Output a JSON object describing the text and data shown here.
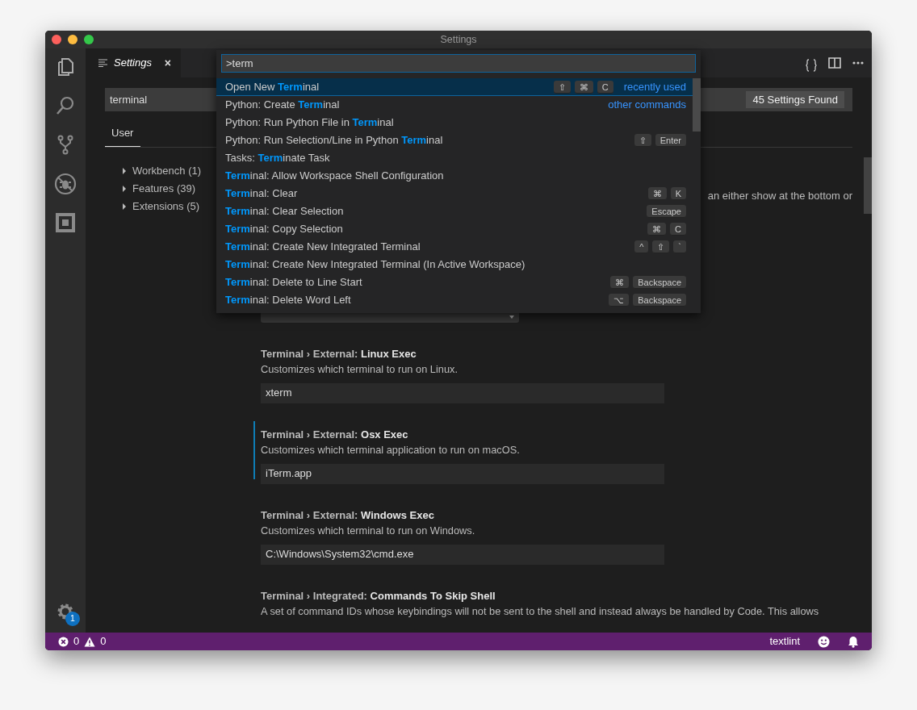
{
  "window": {
    "title": "Settings"
  },
  "activity_bar": {
    "badge": "1"
  },
  "tabs": [
    {
      "label": "Settings",
      "selected": true,
      "close": "×"
    }
  ],
  "search": {
    "value": "terminal",
    "result_count": "45 Settings Found"
  },
  "scope_tabs": [
    {
      "label": "User",
      "selected": true
    }
  ],
  "tree": [
    {
      "label": "Workbench (1)",
      "expanded": false
    },
    {
      "label": "Features (39)",
      "expanded": false
    },
    {
      "label": "Extensions (5)",
      "expanded": false
    }
  ],
  "partial_description": "an either show at the bottom or",
  "settings": [
    {
      "category": "Terminal › External:",
      "name": "Linux Exec",
      "description": "Customizes which terminal to run on Linux.",
      "value": "xterm",
      "focused": false
    },
    {
      "category": "Terminal › External:",
      "name": "Osx Exec",
      "description": "Customizes which terminal application to run on macOS.",
      "value": "iTerm.app",
      "focused": true
    },
    {
      "category": "Terminal › External:",
      "name": "Windows Exec",
      "description": "Customizes which terminal to run on Windows.",
      "value": "C:\\Windows\\System32\\cmd.exe",
      "focused": false
    },
    {
      "category": "Terminal › Integrated:",
      "name": "Commands To Skip Shell",
      "description": "A set of command IDs whose keybindings will not be sent to the shell and instead always be handled by Code. This allows",
      "focused": false
    }
  ],
  "command_palette": {
    "input": ">term",
    "items": [
      {
        "before": "Open New ",
        "match": "Term",
        "after": "inal",
        "keys": [
          "⇧",
          "⌘",
          "C"
        ],
        "tag": "recently used",
        "selected": true
      },
      {
        "before": "Python: Create ",
        "match": "Term",
        "after": "inal",
        "tag": "other commands",
        "selected": false
      },
      {
        "before": "Python: Run Python File in ",
        "match": "Term",
        "after": "inal",
        "selected": false
      },
      {
        "before": "Python: Run Selection/Line in Python ",
        "match": "Term",
        "after": "inal",
        "keys": [
          "⇧",
          "Enter"
        ],
        "selected": false
      },
      {
        "before": "Tasks: ",
        "match": "Term",
        "after": "inate Task",
        "selected": false
      },
      {
        "match": "Term",
        "after": "inal: Allow Workspace Shell Configuration",
        "selected": false
      },
      {
        "match": "Term",
        "after": "inal: Clear",
        "keys": [
          "⌘",
          "K"
        ],
        "selected": false
      },
      {
        "match": "Term",
        "after": "inal: Clear Selection",
        "keys": [
          "Escape"
        ],
        "selected": false
      },
      {
        "match": "Term",
        "after": "inal: Copy Selection",
        "keys": [
          "⌘",
          "C"
        ],
        "selected": false
      },
      {
        "match": "Term",
        "after": "inal: Create New Integrated Terminal",
        "keys": [
          "^",
          "⇧",
          "`"
        ],
        "selected": false
      },
      {
        "match": "Term",
        "after": "inal: Create New Integrated Terminal (In Active Workspace)",
        "selected": false
      },
      {
        "match": "Term",
        "after": "inal: Delete to Line Start",
        "keys": [
          "⌘",
          "Backspace"
        ],
        "selected": false
      },
      {
        "match": "Term",
        "after": "inal: Delete Word Left",
        "keys": [
          "⌥",
          "Backspace"
        ],
        "selected": false
      }
    ]
  },
  "status_bar": {
    "errors": "0",
    "warnings": "0",
    "right_label": "textlint"
  }
}
